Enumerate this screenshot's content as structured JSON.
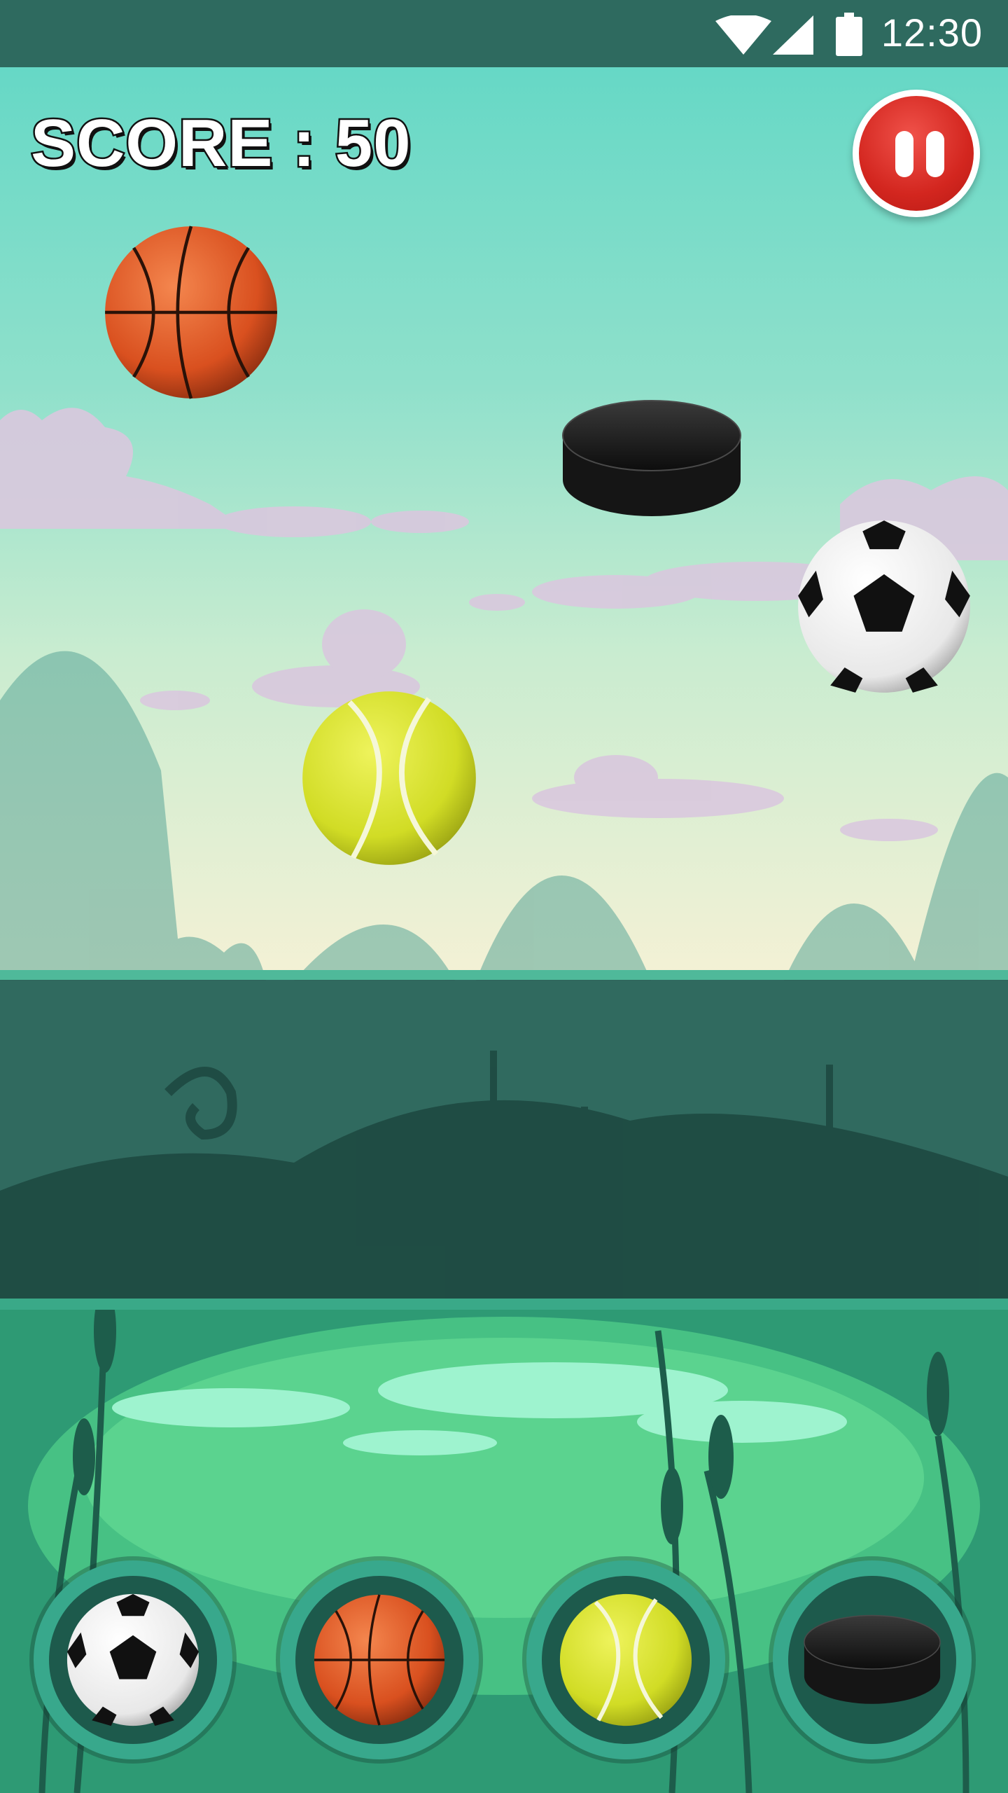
{
  "status_bar": {
    "time": "12:30",
    "icons": [
      "wifi-icon",
      "cell-signal-icon",
      "battery-icon"
    ]
  },
  "hud": {
    "score_label": "SCORE : 50",
    "pause_icon": "pause-icon"
  },
  "falling_objects": [
    {
      "kind": "basketball"
    },
    {
      "kind": "hockey-puck"
    },
    {
      "kind": "soccer-ball"
    },
    {
      "kind": "tennis-ball"
    }
  ],
  "selectors": [
    {
      "kind": "soccer-ball"
    },
    {
      "kind": "basketball"
    },
    {
      "kind": "tennis-ball"
    },
    {
      "kind": "hockey-puck"
    }
  ],
  "colors": {
    "status_bar": "#2e6a5f",
    "pause_red": "#d3261f",
    "selector_ring": "#38a88c",
    "selector_fill": "#1d5a4c",
    "tennis_yellow": "#d9e83a",
    "basketball_orange": "#e2592b"
  }
}
